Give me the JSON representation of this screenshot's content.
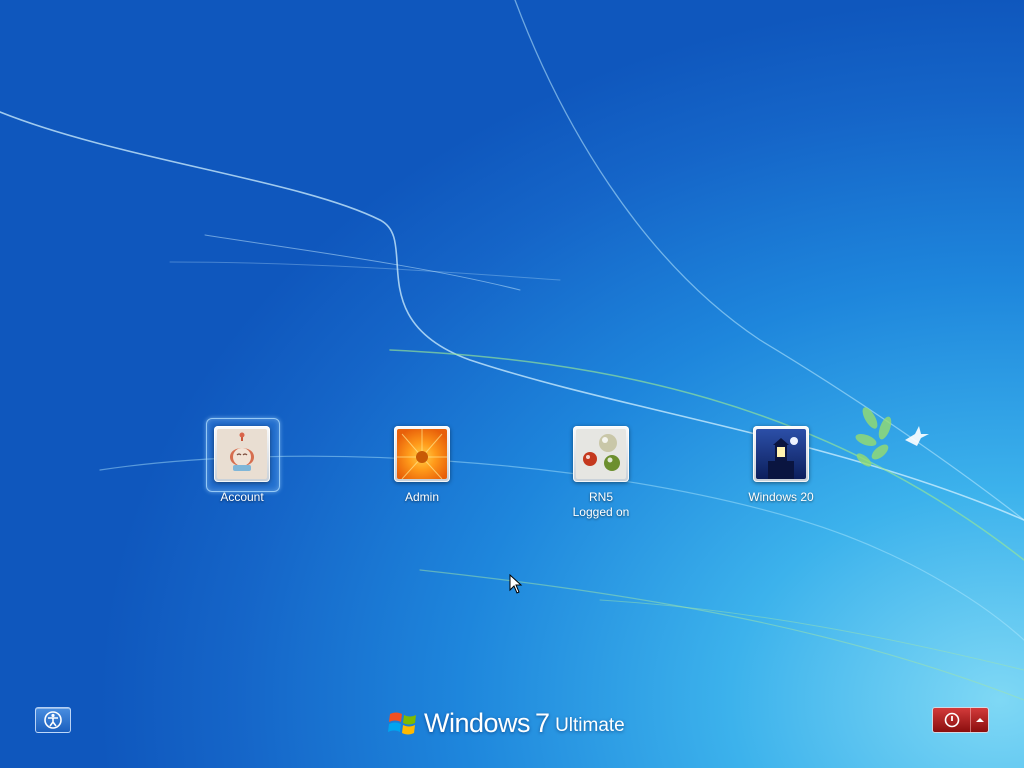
{
  "users": [
    {
      "name": "Account",
      "status": "",
      "selected": true
    },
    {
      "name": "Admin",
      "status": "",
      "selected": false
    },
    {
      "name": "RN5",
      "status": "Logged on",
      "selected": false
    },
    {
      "name": "Windows 20",
      "status": "",
      "selected": false
    }
  ],
  "branding": {
    "product": "Windows",
    "version": "7",
    "edition": "Ultimate"
  },
  "icons": {
    "ease_of_access": "ease-of-access-icon",
    "shutdown": "power-icon",
    "shutdown_options": "arrow-up-icon",
    "logo": "windows-flag-logo",
    "cursor": "mouse-pointer"
  },
  "colors": {
    "background_deep": "#0f57bd",
    "background_light": "#7fd8f5",
    "power_red": "#b71c1c",
    "label_text": "#ffffff"
  }
}
